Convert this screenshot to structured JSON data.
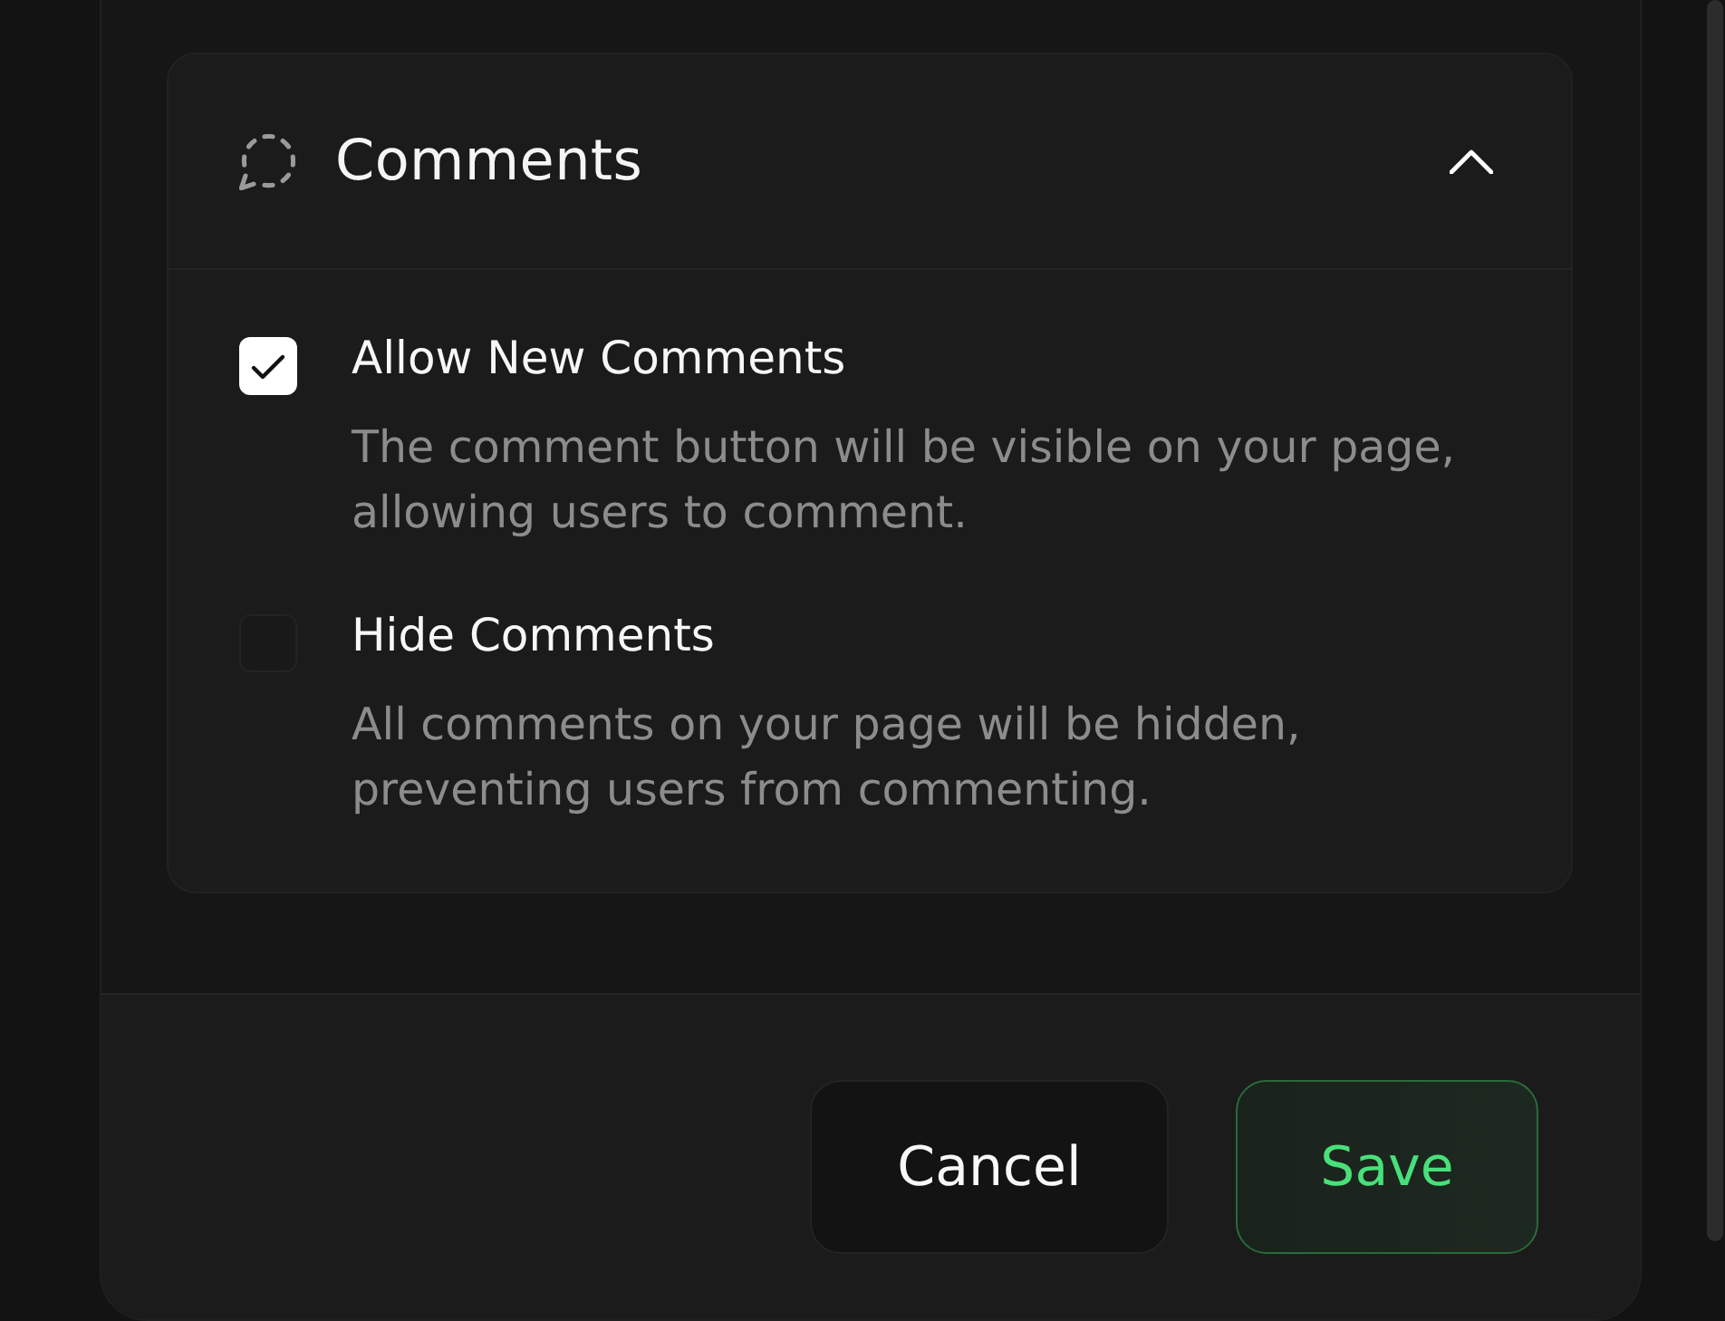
{
  "section": {
    "title": "Comments",
    "expanded": true
  },
  "options": [
    {
      "label": "Allow New Comments",
      "description": "The comment button will be visible on your page, allowing users to comment.",
      "checked": true
    },
    {
      "label": "Hide Comments",
      "description": "All comments on your page will be hidden, preventing users from commenting.",
      "checked": false
    }
  ],
  "buttons": [
    {
      "label": "Cancel",
      "kind": "secondary"
    },
    {
      "label": "Save",
      "kind": "primary"
    }
  ]
}
